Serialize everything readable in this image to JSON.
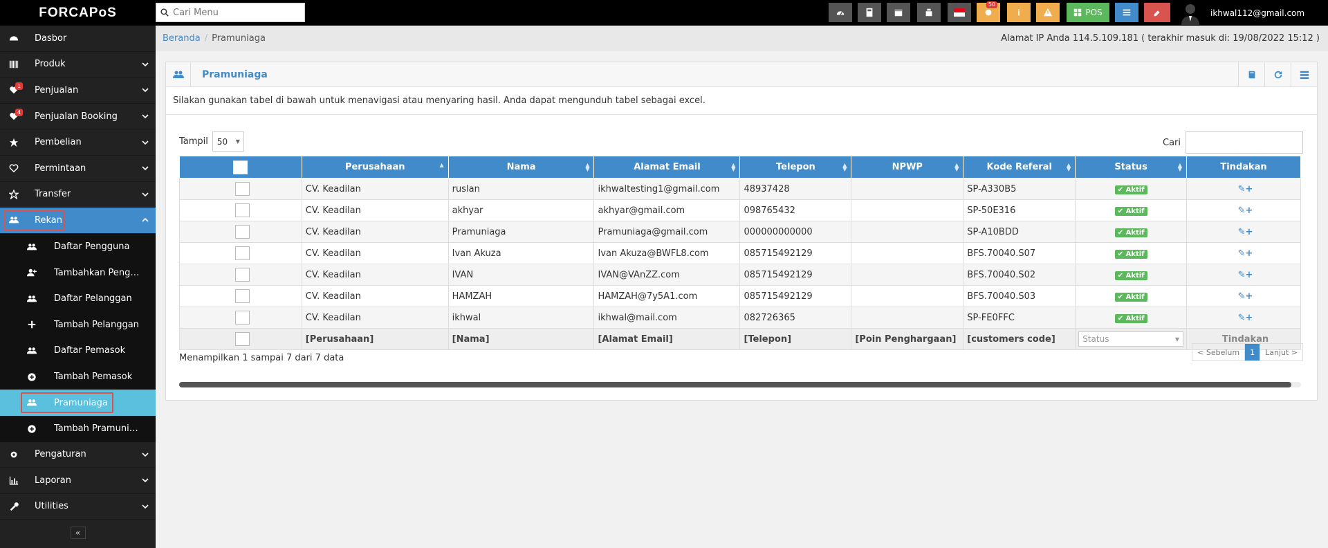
{
  "app": {
    "logo": "FORCAPoS"
  },
  "search": {
    "placeholder": "Cari Menu"
  },
  "topbar": {
    "notif_count": "50",
    "pos_label": "POS",
    "user_email": "ikhwal112@gmail.com"
  },
  "sidebar": {
    "items": [
      {
        "label": "Dasbor",
        "icon": "dashboard-icon"
      },
      {
        "label": "Produk",
        "icon": "barcode-icon"
      },
      {
        "label": "Penjualan",
        "icon": "heart-icon",
        "badge": "1"
      },
      {
        "label": "Penjualan Booking",
        "icon": "heart-icon",
        "badge": "4"
      },
      {
        "label": "Pembelian",
        "icon": "star-icon"
      },
      {
        "label": "Permintaan",
        "icon": "heart-outline-icon"
      },
      {
        "label": "Transfer",
        "icon": "star-outline-icon"
      },
      {
        "label": "Rekan",
        "icon": "users-icon"
      }
    ],
    "sub_items": [
      {
        "label": "Daftar Pengguna"
      },
      {
        "label": "Tambahkan Pengguna"
      },
      {
        "label": "Daftar Pelanggan"
      },
      {
        "label": "Tambah Pelanggan"
      },
      {
        "label": "Daftar Pemasok"
      },
      {
        "label": "Tambah Pemasok"
      },
      {
        "label": "Pramuniaga"
      },
      {
        "label": "Tambah Pramuniaga"
      }
    ],
    "bottom_items": [
      {
        "label": "Pengaturan"
      },
      {
        "label": "Laporan"
      },
      {
        "label": "Utilities"
      }
    ],
    "collapse": "«"
  },
  "breadcrumb": {
    "home": "Beranda",
    "current": "Pramuniaga",
    "ip_info": "Alamat IP Anda 114.5.109.181 ( terakhir masuk di: 19/08/2022 15:12 )"
  },
  "box": {
    "title": "Pramuniaga",
    "intro": "Silakan gunakan tabel di bawah untuk menavigasi atau menyaring hasil. Anda dapat mengunduh tabel sebagai excel."
  },
  "controls": {
    "show_label": "Tampil",
    "show_value": "50",
    "search_label": "Cari"
  },
  "table": {
    "headers": [
      "Perusahaan",
      "Nama",
      "Alamat Email",
      "Telepon",
      "NPWP",
      "Kode Referal",
      "Status",
      "Tindakan"
    ],
    "rows": [
      {
        "perusahaan": "CV. Keadilan",
        "nama": "ruslan",
        "email": "ikhwaltesting1@gmail.com",
        "telepon": "48937428",
        "npwp": "",
        "kode": "SP-A330B5",
        "status": "Aktif"
      },
      {
        "perusahaan": "CV. Keadilan",
        "nama": "akhyar",
        "email": "akhyar@gmail.com",
        "telepon": "098765432",
        "npwp": "",
        "kode": "SP-50E316",
        "status": "Aktif"
      },
      {
        "perusahaan": "CV. Keadilan",
        "nama": "Pramuniaga",
        "email": "Pramuniaga@gmail.com",
        "telepon": "000000000000",
        "npwp": "",
        "kode": "SP-A10BDD",
        "status": "Aktif"
      },
      {
        "perusahaan": "CV. Keadilan",
        "nama": "Ivan Akuza",
        "email": "Ivan Akuza@BWFL8.com",
        "telepon": "085715492129",
        "npwp": "",
        "kode": "BFS.70040.S07",
        "status": "Aktif"
      },
      {
        "perusahaan": "CV. Keadilan",
        "nama": "IVAN",
        "email": "IVAN@VAnZZ.com",
        "telepon": "085715492129",
        "npwp": "",
        "kode": "BFS.70040.S02",
        "status": "Aktif"
      },
      {
        "perusahaan": "CV. Keadilan",
        "nama": "HAMZAH",
        "email": "HAMZAH@7y5A1.com",
        "telepon": "085715492129",
        "npwp": "",
        "kode": "BFS.70040.S03",
        "status": "Aktif"
      },
      {
        "perusahaan": "CV. Keadilan",
        "nama": "ikhwal",
        "email": "ikhwal@mail.com",
        "telepon": "082726365",
        "npwp": "",
        "kode": "SP-FE0FFC",
        "status": "Aktif"
      }
    ],
    "footer": [
      "[Perusahaan]",
      "[Nama]",
      "[Alamat Email]",
      "[Telepon]",
      "[Poin Penghargaan]",
      "[customers code]",
      "Status",
      "Tindakan"
    ]
  },
  "info": {
    "showing": "Menampilkan 1 sampai 7 dari 7 data"
  },
  "pager": {
    "prev": "< Sebelum",
    "page": "1",
    "next": "Lanjut >"
  },
  "colors": {
    "primary": "#428bca",
    "active_sub": "#5bc0de",
    "success": "#5cb85c",
    "highlight": "#d9534f"
  }
}
